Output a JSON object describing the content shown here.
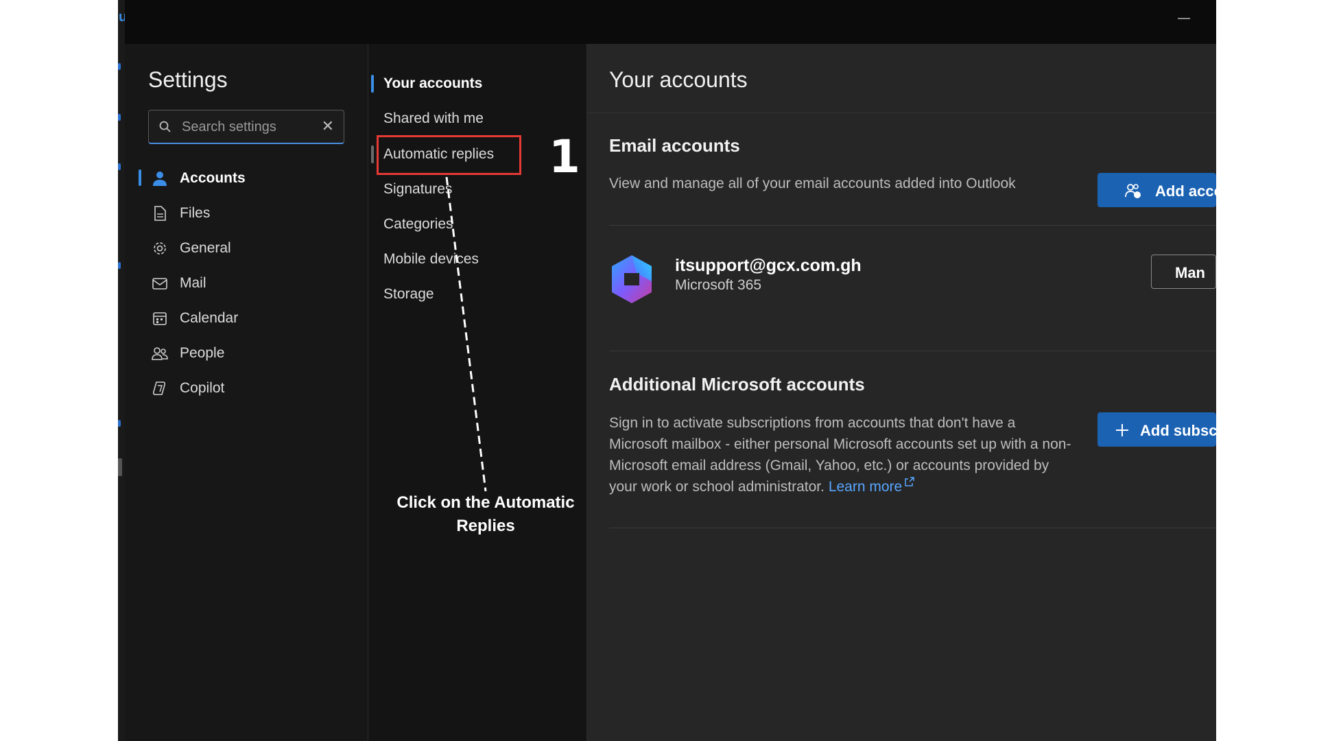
{
  "window": {
    "minimize_icon": "minimize-icon"
  },
  "settings": {
    "title": "Settings",
    "search": {
      "placeholder": "Search settings",
      "search_icon": "search-icon",
      "clear_icon": "close-icon"
    },
    "nav": [
      {
        "label": "Accounts",
        "icon": "person-icon",
        "active": true
      },
      {
        "label": "Files",
        "icon": "file-icon",
        "active": false
      },
      {
        "label": "General",
        "icon": "gear-icon",
        "active": false
      },
      {
        "label": "Mail",
        "icon": "mail-icon",
        "active": false
      },
      {
        "label": "Calendar",
        "icon": "calendar-icon",
        "active": false
      },
      {
        "label": "People",
        "icon": "people-icon",
        "active": false
      },
      {
        "label": "Copilot",
        "icon": "copilot-icon",
        "active": false
      }
    ]
  },
  "subnav": [
    {
      "label": "Your accounts",
      "active": true
    },
    {
      "label": "Shared with me",
      "active": false
    },
    {
      "label": "Automatic replies",
      "active": false,
      "hover": true
    },
    {
      "label": "Signatures",
      "active": false
    },
    {
      "label": "Categories",
      "active": false
    },
    {
      "label": "Mobile devices",
      "active": false
    },
    {
      "label": "Storage",
      "active": false
    }
  ],
  "content": {
    "title": "Your accounts",
    "email_accounts": {
      "title": "Email accounts",
      "description": "View and manage all of your email accounts added into Outlook",
      "add_button": "Add acco",
      "account": {
        "email": "itsupport@gcx.com.gh",
        "type": "Microsoft 365",
        "manage_button": "Man"
      }
    },
    "additional": {
      "title": "Additional Microsoft accounts",
      "description": "Sign in to activate subscriptions from accounts that don't have a Microsoft mailbox - either personal Microsoft accounts set up with a non-Microsoft email address (Gmail, Yahoo, etc.) or accounts provided by your work or school administrator.",
      "learn_more": "Learn more",
      "add_button": "Add subscr"
    }
  },
  "annotation": {
    "step_number": "1",
    "instruction": "Click on the Automatic Replies"
  },
  "colors": {
    "accent": "#1b62b3",
    "highlight": "#e53935",
    "link": "#58a6ff"
  }
}
